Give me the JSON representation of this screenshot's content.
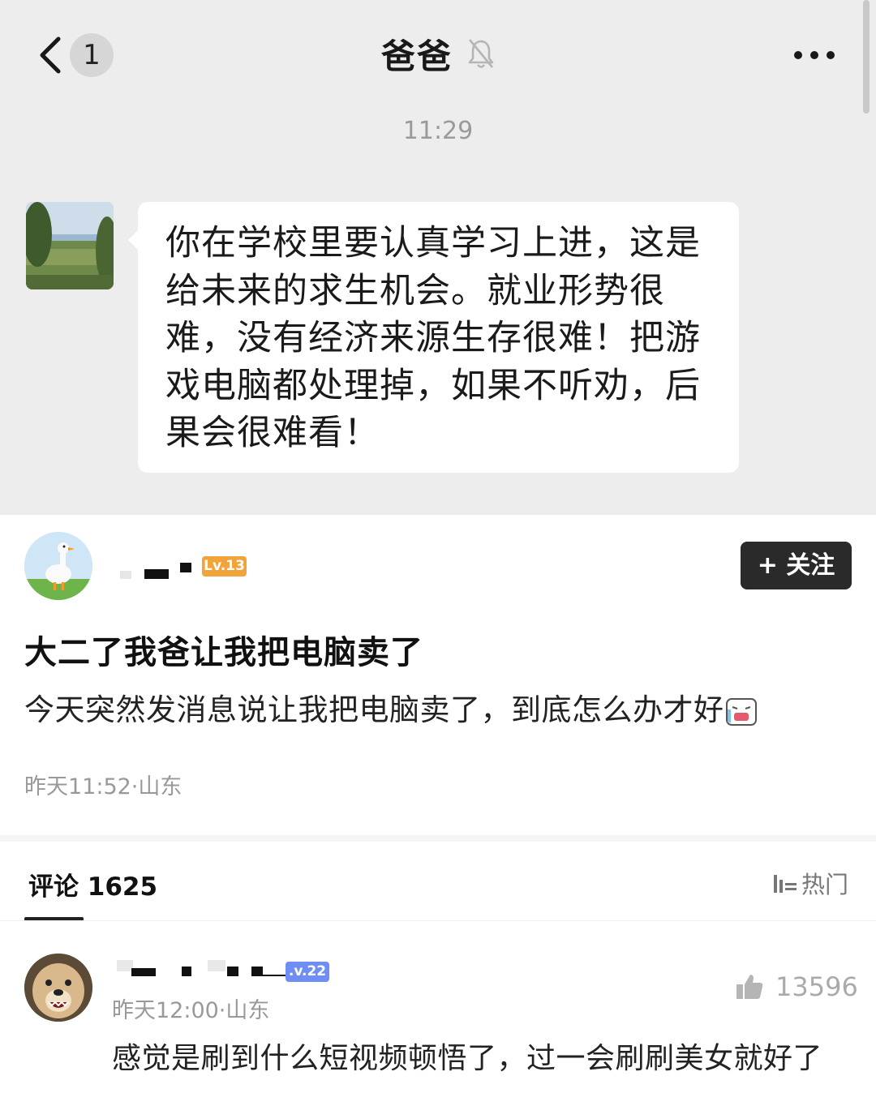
{
  "header": {
    "back_count": "1",
    "title": "爸爸",
    "mute_icon": "bell-off-icon",
    "more_icon": "more-dots-icon"
  },
  "chat": {
    "timestamp": "11:29",
    "message": "你在学校里要认真学习上进，这是给未来的求生机会。就业形势很难，没有经济来源生存很难！把游戏电脑都处理掉，如果不听劝，后果会很难看！"
  },
  "post": {
    "level": "Lv.13",
    "follow_label": "+ 关注",
    "title": "大二了我爸让我把电脑卖了",
    "body": "今天突然发消息说让我把电脑卖了，到底怎么办才好",
    "meta": "昨天11:52·山东"
  },
  "comments": {
    "label": "评论 1625",
    "sort_label": "热门",
    "items": [
      {
        "level": ".v.22",
        "meta": "昨天12:00·山东",
        "likes": "13596",
        "text": "感觉是刷到什么短视频顿悟了，过一会刷刷美女就好了"
      }
    ]
  },
  "colors": {
    "chat_bg": "#ededed",
    "lv13_badge": "#f2a33a",
    "lv22_badge": "#6f8ef5",
    "follow_button": "#2a2a2a"
  }
}
